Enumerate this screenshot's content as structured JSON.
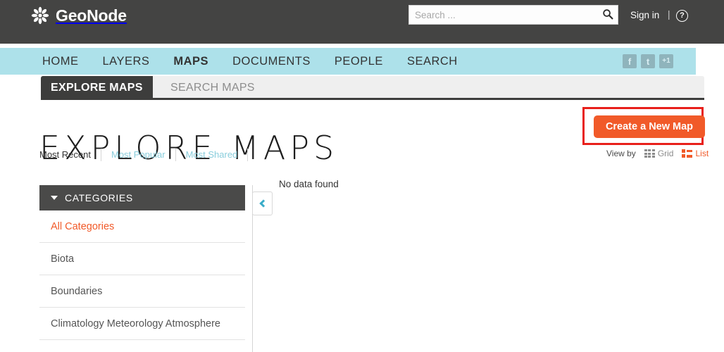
{
  "header": {
    "brand": "GeoNode",
    "brand_icon": "geonode-asterisk-logo",
    "search": {
      "value": "",
      "placeholder": "Search ...",
      "icon": "search-icon"
    },
    "signin_label": "Sign in",
    "separator": "|",
    "help_icon_label": "?"
  },
  "nav": {
    "items": [
      {
        "label": "HOME",
        "active": false
      },
      {
        "label": "LAYERS",
        "active": false
      },
      {
        "label": "MAPS",
        "active": true
      },
      {
        "label": "DOCUMENTS",
        "active": false
      },
      {
        "label": "PEOPLE",
        "active": false
      },
      {
        "label": "SEARCH",
        "active": false
      }
    ],
    "social": [
      {
        "name": "facebook-icon",
        "glyph": "f"
      },
      {
        "name": "twitter-icon",
        "glyph": "t"
      },
      {
        "name": "google-plus-one-icon",
        "glyph": "+1"
      }
    ]
  },
  "tabs": [
    {
      "label": "EXPLORE MAPS",
      "active": true
    },
    {
      "label": "SEARCH MAPS",
      "active": false
    }
  ],
  "page": {
    "title": "EXPLORE MAPS",
    "no_data_text": "No data found"
  },
  "sort": {
    "items": [
      {
        "label": "Most Recent",
        "active": true
      },
      {
        "label": "Most Popular",
        "active": false
      },
      {
        "label": "Most Shared",
        "active": false
      }
    ]
  },
  "actions": {
    "create_map_label": "Create a New Map",
    "highlight_color": "#e8201b",
    "button_color": "#f15a29"
  },
  "viewby": {
    "label": "View by",
    "options": [
      {
        "label": "Grid",
        "icon": "grid-icon",
        "active": false
      },
      {
        "label": "List",
        "icon": "list-icon",
        "active": true
      }
    ]
  },
  "categories": {
    "header": "CATEGORIES",
    "items": [
      {
        "label": "All Categories",
        "active": true
      },
      {
        "label": "Biota",
        "active": false
      },
      {
        "label": "Boundaries",
        "active": false
      },
      {
        "label": "Climatology Meteorology Atmosphere",
        "active": false
      }
    ]
  },
  "colors": {
    "header_dark": "#444443",
    "nav_blue": "#ade1ea",
    "accent_orange": "#f15a29",
    "link_blue": "#89cddc",
    "teal": "#3aacc8"
  }
}
